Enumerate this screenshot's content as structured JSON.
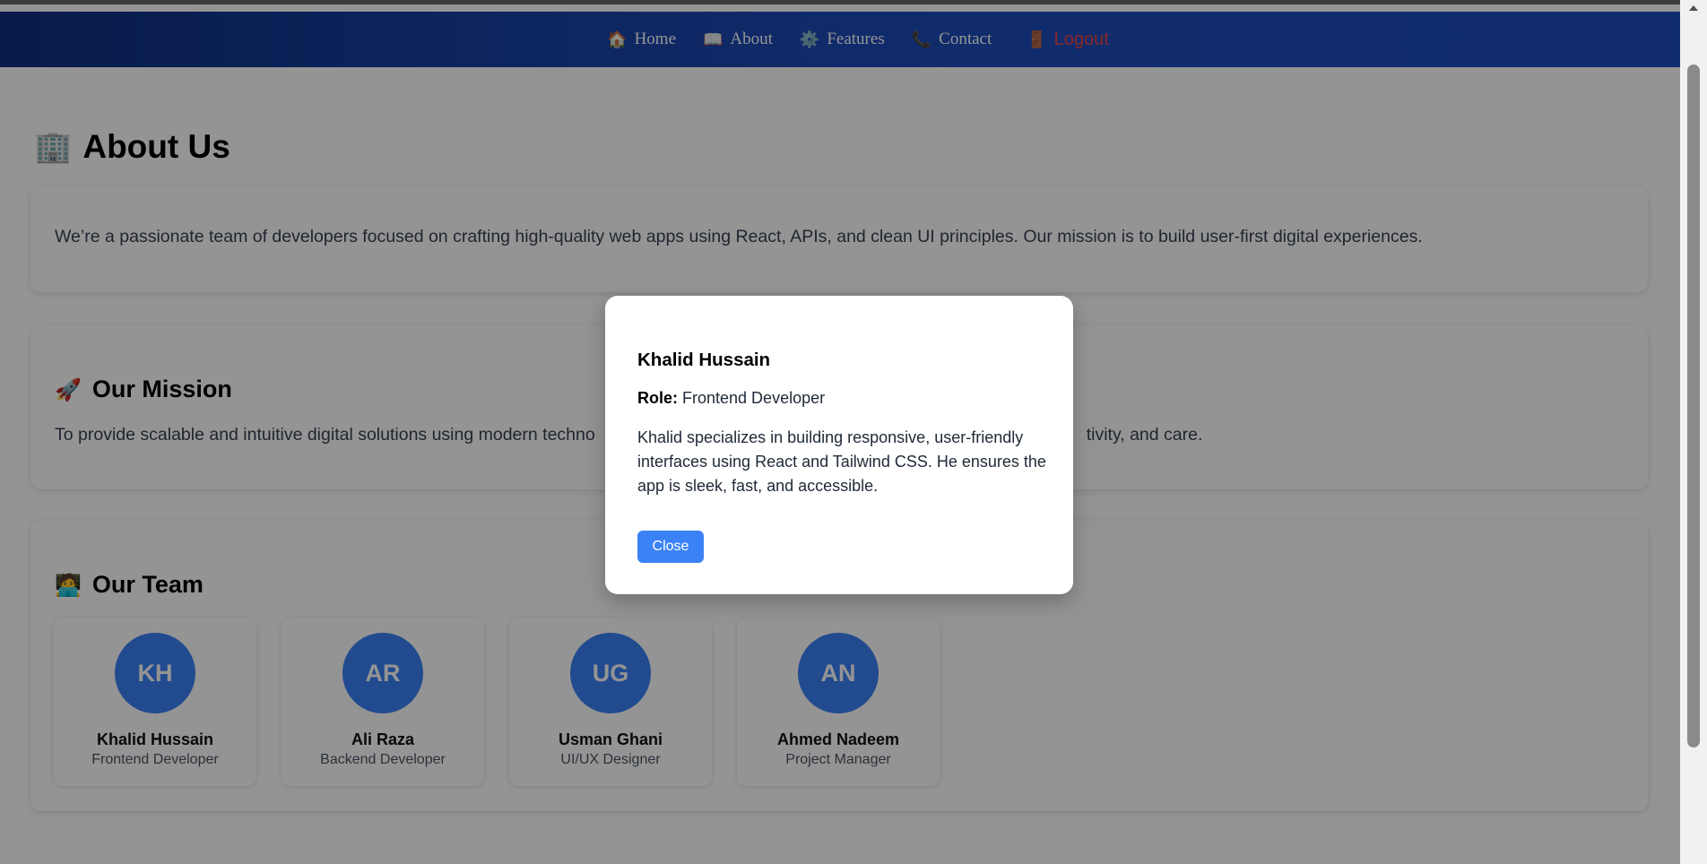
{
  "nav": {
    "items": [
      {
        "icon": "🏠",
        "label": "Home"
      },
      {
        "icon": "📖",
        "label": "About"
      },
      {
        "icon": "⚙️",
        "label": "Features"
      },
      {
        "icon": "📞",
        "label": "Contact"
      }
    ],
    "logout": {
      "icon": "🚪",
      "label": "Logout"
    }
  },
  "page": {
    "title_icon": "🏢",
    "title": "About Us",
    "intro": "We’re a passionate team of developers focused on crafting high-quality web apps using React, APIs, and clean UI principles. Our mission is to build user-first digital experiences.",
    "mission": {
      "icon": "🚀",
      "heading": "Our Mission",
      "text_visible": "To provide scalable and intuitive digital solutions using modern techno",
      "text_tail_visible": "tivity, and care."
    },
    "team": {
      "icon": "🧑‍💻",
      "heading": "Our Team",
      "members": [
        {
          "initials": "KH",
          "name": "Khalid Hussain",
          "role": "Frontend Developer"
        },
        {
          "initials": "AR",
          "name": "Ali Raza",
          "role": "Backend Developer"
        },
        {
          "initials": "UG",
          "name": "Usman Ghani",
          "role": "UI/UX Designer"
        },
        {
          "initials": "AN",
          "name": "Ahmed Nadeem",
          "role": "Project Manager"
        }
      ]
    }
  },
  "modal": {
    "name": "Khalid Hussain",
    "role_label": "Role:",
    "role": "Frontend Developer",
    "description": "Khalid specializes in building responsive, user-friendly interfaces using React and Tailwind CSS. He ensures the app is sleek, fast, and accessible.",
    "close_label": "Close"
  },
  "colors": {
    "nav_start": "#0f2f82",
    "nav_end": "#1e4fc2",
    "accent": "#3b82f6",
    "logout": "#ef4444"
  }
}
